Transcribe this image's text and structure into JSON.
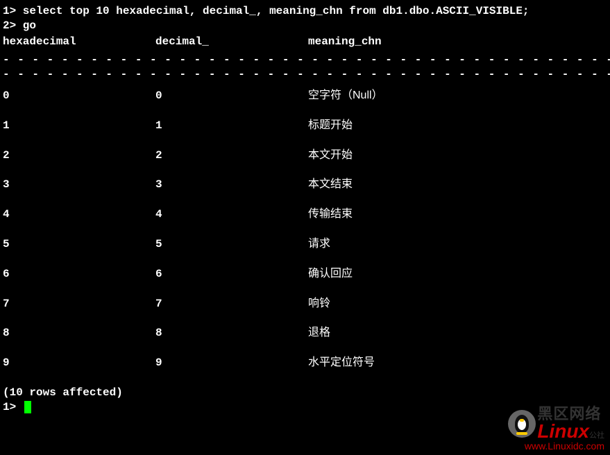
{
  "prompt1": "1> select top 10 hexadecimal, decimal_, meaning_chn from db1.dbo.ASCII_VISIBLE;",
  "prompt2": "2> go",
  "headers": {
    "hexadecimal": "hexadecimal",
    "decimal": "decimal_",
    "meaning": "meaning_chn"
  },
  "separator_line": "- - - - - - - - - - - - - - - - - - - - - - - - - - - - - - - - - - - - - - - - - - - - - - - - - - - - -",
  "rows": [
    {
      "hex": "0",
      "dec": "0",
      "meaning": "空字符（Null）"
    },
    {
      "hex": "1",
      "dec": "1",
      "meaning": "标题开始"
    },
    {
      "hex": "2",
      "dec": "2",
      "meaning": "本文开始"
    },
    {
      "hex": "3",
      "dec": "3",
      "meaning": "本文结束"
    },
    {
      "hex": "4",
      "dec": "4",
      "meaning": "传输结束"
    },
    {
      "hex": "5",
      "dec": "5",
      "meaning": "请求"
    },
    {
      "hex": "6",
      "dec": "6",
      "meaning": "确认回应"
    },
    {
      "hex": "7",
      "dec": "7",
      "meaning": "响铃"
    },
    {
      "hex": "8",
      "dec": "8",
      "meaning": "退格"
    },
    {
      "hex": "9",
      "dec": "9",
      "meaning": "水平定位符号"
    }
  ],
  "footer": {
    "affected": "(10 rows affected)",
    "prompt": "1> "
  },
  "watermark": {
    "chinese": "黑区网络",
    "brand": "Linux",
    "sub": "公社",
    "url": "www.Linuxidc.com"
  }
}
